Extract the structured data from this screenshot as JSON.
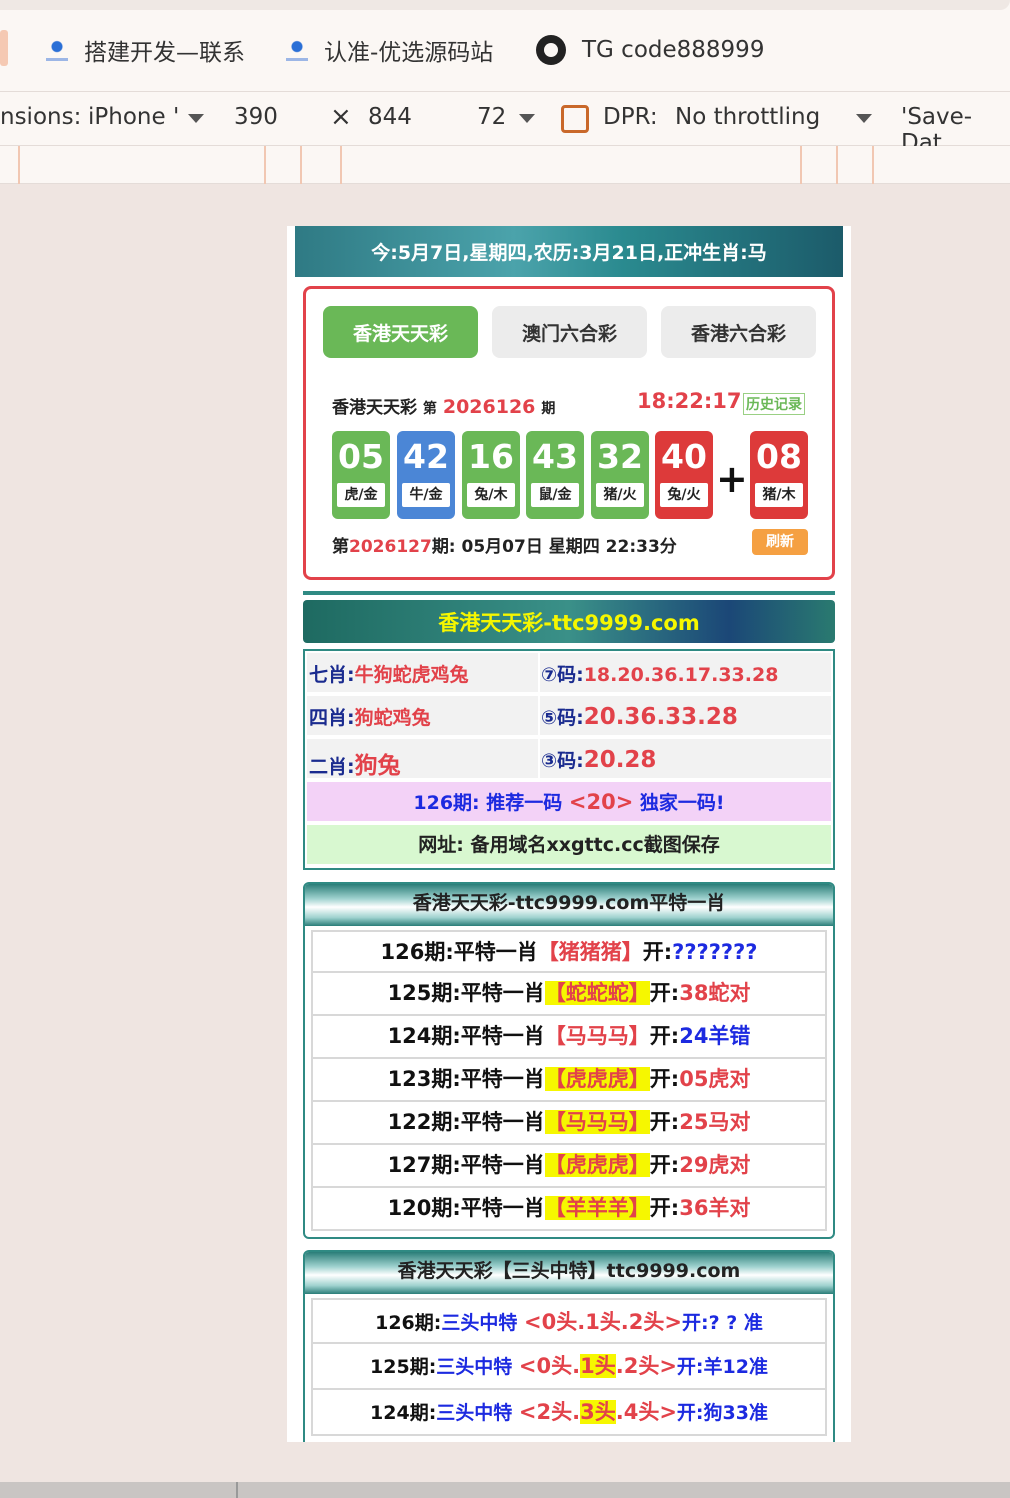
{
  "browser": {
    "bookmarks": [
      "搭建开发—联系",
      "认准-优选源码站",
      "TG code888999"
    ],
    "devtools": {
      "dimensions_label": "nsions:",
      "device": "iPhone '",
      "width": "390",
      "times": "×",
      "height": "844",
      "zoom": "72",
      "dpr_label": "DPR:",
      "throttling": "No throttling",
      "save_data": "'Save-Dat"
    }
  },
  "page": {
    "date_bar": "今:5月7日,星期四,农历:3月21日,正冲生肖:马",
    "tabs": [
      "香港天天彩",
      "澳门六合彩",
      "香港六合彩"
    ],
    "draw": {
      "lottery_name": "香港天天彩",
      "period_prefix": "第",
      "period": "2026126",
      "period_suffix": "期",
      "clock": "18:22:17",
      "history": "历史记录",
      "balls": [
        {
          "num": "05",
          "zodiac": "虎/金",
          "color": "green"
        },
        {
          "num": "42",
          "zodiac": "牛/金",
          "color": "blue"
        },
        {
          "num": "16",
          "zodiac": "兔/木",
          "color": "green"
        },
        {
          "num": "43",
          "zodiac": "鼠/金",
          "color": "green"
        },
        {
          "num": "32",
          "zodiac": "猪/火",
          "color": "green"
        },
        {
          "num": "40",
          "zodiac": "兔/火",
          "color": "red"
        },
        {
          "num": "08",
          "zodiac": "猪/木",
          "color": "red"
        }
      ],
      "plus": "+",
      "next_prefix": "第",
      "next_period": "2026127",
      "next_suffix": "期:  05月07日 星期四 22:33分",
      "refresh": "刷新"
    },
    "title_bar": "香港天天彩-ttc9999.com",
    "predictions": [
      {
        "left_label": "七肖:",
        "left_value": "牛狗蛇虎鸡兔",
        "right_label": "⑦码:",
        "right_value": "18.20.36.17.33.28"
      },
      {
        "left_label": "四肖:",
        "left_value": "狗蛇鸡兔",
        "right_label": "⑤码:",
        "right_value": "20.36.33.28"
      },
      {
        "left_label": "二肖:",
        "left_value": "狗兔",
        "right_label": "③码:",
        "right_value": "20.28"
      }
    ],
    "recommend": {
      "prefix": "126期: 推荐一码 ",
      "value": "<20>",
      "suffix": " 独家一码!"
    },
    "url_line": "网址: 备用域名xxgttc.cc截图保存",
    "section1": {
      "title": "香港天天彩-ttc9999.com平特一肖",
      "rows": [
        {
          "period": "126期:平特一肖",
          "pick": "【猪猪猪】",
          "open": "开:",
          "result": "???????",
          "result_color": "blue",
          "hl": ""
        },
        {
          "period": "125期:平特一肖",
          "pick": "【蛇蛇蛇】",
          "open": "开:",
          "result": "38蛇对",
          "result_color": "red",
          "hl": "all"
        },
        {
          "period": "124期:平特一肖",
          "pick": "【马马马】",
          "open": "开:",
          "result": "24羊错",
          "result_color": "blue-black",
          "hl": ""
        },
        {
          "period": "123期:平特一肖",
          "pick": "【虎虎虎】",
          "open": "开:",
          "result": "05虎对",
          "result_color": "red",
          "hl": "all"
        },
        {
          "period": "122期:平特一肖",
          "pick": "【马马马】",
          "open": "开:",
          "result": "25马对",
          "result_color": "red",
          "hl": "all"
        },
        {
          "period": "127期:平特一肖",
          "pick": "【虎虎虎】",
          "open": "开:",
          "result": "29虎对",
          "result_color": "red",
          "hl": "all"
        },
        {
          "period": "120期:平特一肖",
          "pick": "【羊羊羊】",
          "open": "开:",
          "result": "36羊对",
          "result_color": "red",
          "hl": "all"
        }
      ]
    },
    "section2": {
      "title": "香港天天彩【三头中特】ttc9999.com",
      "rows": [
        {
          "period": "126期:",
          "label": "三头中特 ",
          "pick": [
            "<0头.",
            "1头.",
            "2头>"
          ],
          "hl_index": -1,
          "open": "开:? ? 准"
        },
        {
          "period": "125期:",
          "label": "三头中特 ",
          "pick": [
            "<0头.",
            "1头",
            ".2头>"
          ],
          "hl_index": 1,
          "open": "开:羊12准"
        },
        {
          "period": "124期:",
          "label": "三头中特 ",
          "pick": [
            "<2头.",
            "3头",
            ".4头>"
          ],
          "hl_index": 1,
          "open": "开:狗33准"
        }
      ]
    }
  }
}
